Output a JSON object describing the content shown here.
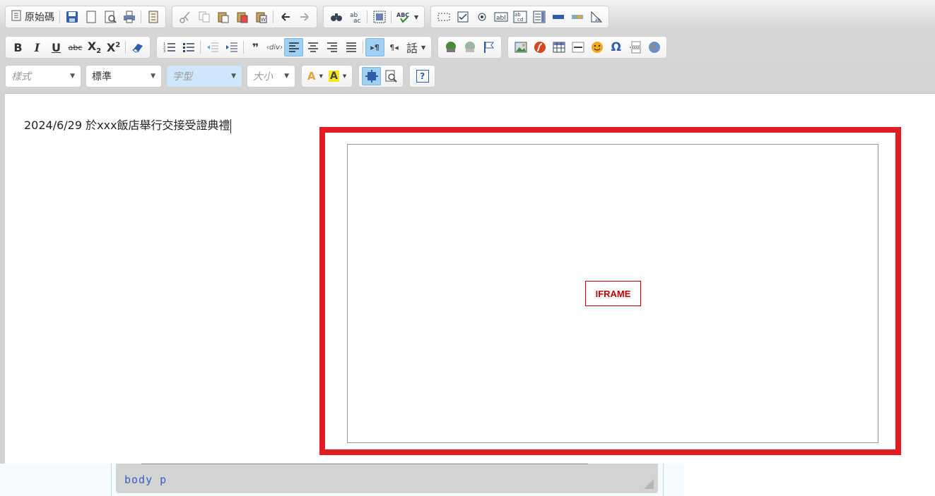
{
  "toolbar": {
    "source_label": "原始碼",
    "style_combo": "樣式",
    "format_combo": "標準",
    "font_combo": "字型",
    "size_combo": "大小",
    "language_label": "話",
    "spell_label": "ABC",
    "special_char": "Ω",
    "help_label": "?"
  },
  "editor": {
    "content_text": "2024/6/29 於xxx飯店舉行交接受證典禮",
    "iframe_placeholder": "IFRAME"
  },
  "status_bar": {
    "element_path": "body p"
  },
  "colors": {
    "highlight_frame": "#e31c23",
    "active_button": "#9fd0f4",
    "toolbar_bg": "#d3d3d3",
    "path_text": "#3a5cc4"
  }
}
